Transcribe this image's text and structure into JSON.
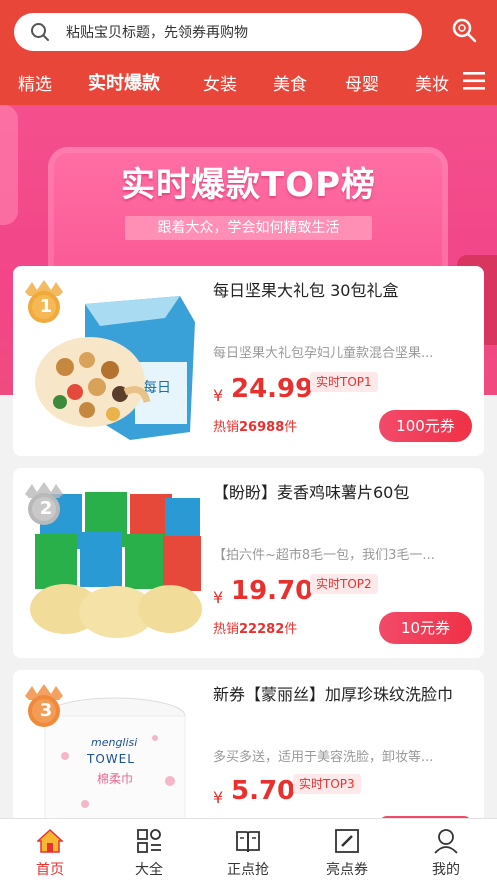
{
  "search": {
    "placeholder": "粘贴宝贝标题，先领券再购物",
    "icon": "search-icon",
    "action_icon": "search-magnifier-icon"
  },
  "tabs": [
    {
      "label": "精选",
      "active": false
    },
    {
      "label": "实时爆款",
      "active": true
    },
    {
      "label": "女装",
      "active": false
    },
    {
      "label": "美食",
      "active": false
    },
    {
      "label": "母婴",
      "active": false
    },
    {
      "label": "美妆",
      "active": false
    }
  ],
  "menu_icon": "hamburger-menu-icon",
  "banner": {
    "title": "实时爆款TOP榜",
    "subtitle": "跟着大众，学会如何精致生活"
  },
  "products": [
    {
      "rank": "1",
      "title": "每日坚果大礼包 30包礼盒",
      "desc": "每日坚果大礼包孕妇儿童款混合坚果...",
      "currency": "¥",
      "price": "24.99",
      "top_tag": "实时TOP1",
      "sales_prefix": "热销",
      "sales_count": "26988",
      "sales_suffix": "件",
      "coupon": "100元券",
      "image_label": "nuts-gift-box"
    },
    {
      "rank": "2",
      "title": "【盼盼】麦香鸡味薯片60包",
      "desc": "【拍六件~超市8毛一包，我们3毛一...",
      "currency": "¥",
      "price": "19.70",
      "top_tag": "实时TOP2",
      "sales_prefix": "热销",
      "sales_count": "22282",
      "sales_suffix": "件",
      "coupon": "10元券",
      "image_label": "chips-packs"
    },
    {
      "rank": "3",
      "title": "新券【蒙丽丝】加厚珍珠纹洗脸巾",
      "desc": "多买多送，适用于美容洗脸，卸妆等...",
      "currency": "¥",
      "price": "5.70",
      "top_tag": "实时TOP3",
      "sales_prefix": "",
      "sales_count": "",
      "sales_suffix": "",
      "coupon": "",
      "image_label": "face-towel-roll",
      "image_brand": "menglisi",
      "image_brand_mark": "TOWEL",
      "image_caption": "棉柔巾"
    }
  ],
  "colors": {
    "brand_red": "#e9463a",
    "banner_pink": "#f24688",
    "price_red": "#e8312f",
    "gold_badge": "#f0a93a",
    "silver_badge": "#b9b9b9",
    "bronze_badge": "#f0893a"
  },
  "bottom_nav": [
    {
      "label": "首页",
      "icon": "home-icon",
      "active": true
    },
    {
      "label": "大全",
      "icon": "grid-icon",
      "active": false
    },
    {
      "label": "正点抢",
      "icon": "book-icon",
      "active": false
    },
    {
      "label": "亮点券",
      "icon": "edit-icon",
      "active": false
    },
    {
      "label": "我的",
      "icon": "user-icon",
      "active": false
    }
  ]
}
